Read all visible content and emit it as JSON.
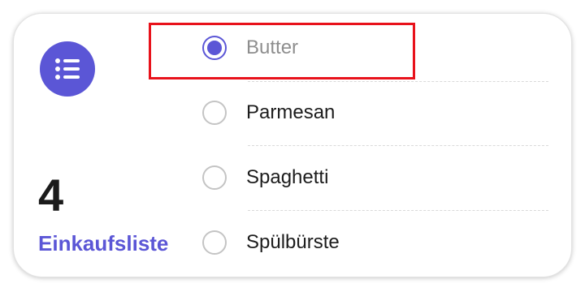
{
  "list": {
    "count": "4",
    "name": "Einkaufsliste",
    "accent_color": "#5b56d6"
  },
  "icons": {
    "list": "list-bullet-icon"
  },
  "items": [
    {
      "label": "Butter",
      "checked": true
    },
    {
      "label": "Parmesan",
      "checked": false
    },
    {
      "label": "Spaghetti",
      "checked": false
    },
    {
      "label": "Spülbürste",
      "checked": false
    }
  ],
  "highlight_color": "#e8121b"
}
